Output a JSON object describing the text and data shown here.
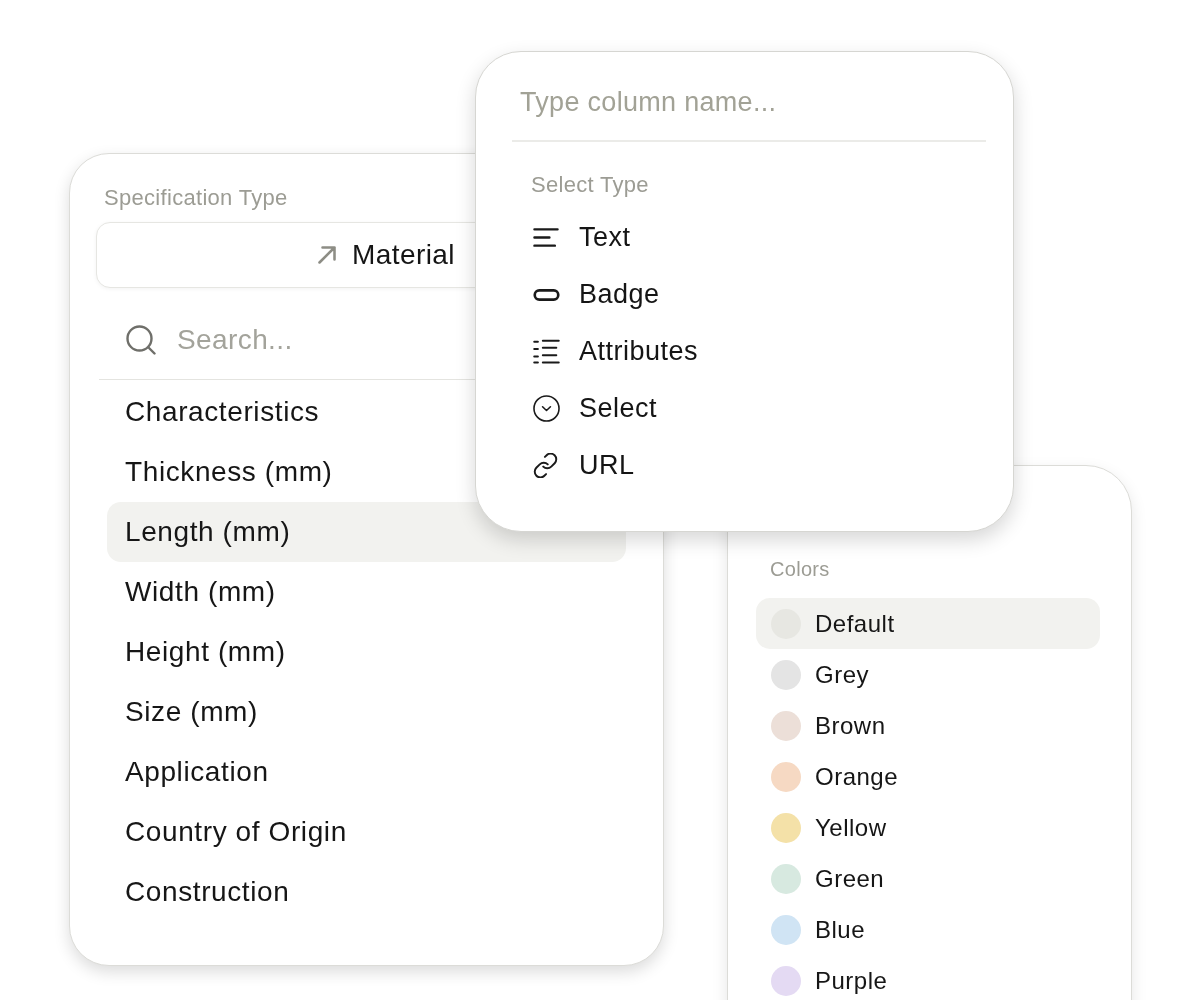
{
  "specification_panel": {
    "label": "Specification Type",
    "type_button": {
      "label": "Material"
    },
    "search": {
      "placeholder": "Search..."
    },
    "items": [
      {
        "label": "Characteristics",
        "selected": false
      },
      {
        "label": "Thickness (mm)",
        "selected": false
      },
      {
        "label": "Length (mm)",
        "selected": true
      },
      {
        "label": "Width (mm)",
        "selected": false
      },
      {
        "label": "Height (mm)",
        "selected": false
      },
      {
        "label": "Size (mm)",
        "selected": false
      },
      {
        "label": "Application",
        "selected": false
      },
      {
        "label": "Country of Origin",
        "selected": false
      },
      {
        "label": "Construction",
        "selected": false
      }
    ]
  },
  "column_popover": {
    "name_field": {
      "placeholder": "Type column name..."
    },
    "section_label": "Select Type",
    "types": [
      {
        "kind": "text",
        "label": "Text"
      },
      {
        "kind": "badge",
        "label": "Badge"
      },
      {
        "kind": "attributes",
        "label": "Attributes"
      },
      {
        "kind": "select",
        "label": "Select"
      },
      {
        "kind": "url",
        "label": "URL"
      }
    ]
  },
  "colors_panel": {
    "label": "Colors",
    "colors": [
      {
        "label": "Default",
        "color": "#e7e7e2",
        "selected": true
      },
      {
        "label": "Grey",
        "color": "#e4e4e4",
        "selected": false
      },
      {
        "label": "Brown",
        "color": "#ecdfd8",
        "selected": false
      },
      {
        "label": "Orange",
        "color": "#f6d9c3",
        "selected": false
      },
      {
        "label": "Yellow",
        "color": "#f4e1a8",
        "selected": false
      },
      {
        "label": "Green",
        "color": "#d7e9e0",
        "selected": false
      },
      {
        "label": "Blue",
        "color": "#d0e4f4",
        "selected": false
      },
      {
        "label": "Purple",
        "color": "#e4daf3",
        "selected": false
      }
    ]
  }
}
